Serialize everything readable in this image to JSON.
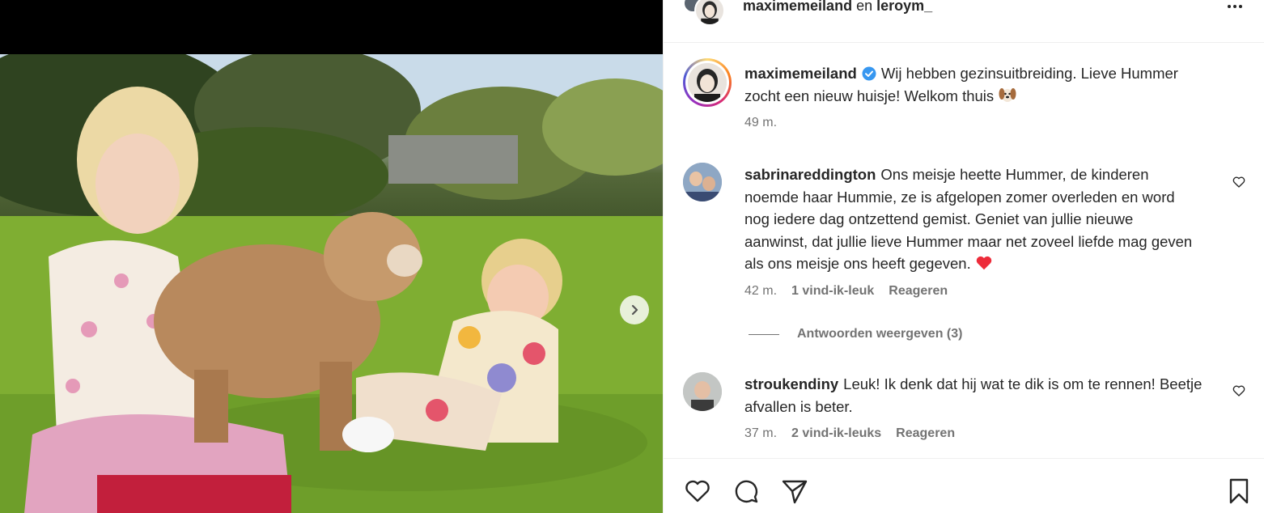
{
  "header": {
    "user1": "maximemeiland",
    "conjunction": "en",
    "user2": "leroym_"
  },
  "caption": {
    "username": "maximemeiland",
    "verified": true,
    "text": "Wij hebben gezinsuitbreiding. Lieve Hummer zocht een nieuw huisje! Welkom thuis",
    "emoji": "dog-face",
    "time": "49 m."
  },
  "comments": [
    {
      "username": "sabrinareddington",
      "text": "Ons meisje heette Hummer, de kinderen noemde haar Hummie, ze is afgelopen zomer overleden en word nog iedere dag ontzettend gemist. Geniet van jullie nieuwe aanwinst, dat jullie lieve Hummer maar net zoveel liefde mag geven als ons meisje ons heeft gegeven.",
      "emoji": "red-heart",
      "time": "42 m.",
      "likes": "1 vind-ik-leuk",
      "reply": "Reageren",
      "view_replies": "Antwoorden weergeven (3)"
    },
    {
      "username": "stroukendiny",
      "text": "Leuk! Ik denk dat hij wat te dik is om te rennen! Beetje afvallen is beter.",
      "time": "37 m.",
      "likes": "2 vind-ik-leuks",
      "reply": "Reageren"
    }
  ],
  "icons": {
    "next": "chevron-right-icon",
    "more": "more-horizontal-icon",
    "like": "heart-icon",
    "comment": "comment-icon",
    "share": "send-icon",
    "save": "bookmark-icon"
  },
  "colors": {
    "verified": "#3797f0",
    "heart": "#ed2c3a",
    "muted": "#737373",
    "text": "#262626"
  }
}
